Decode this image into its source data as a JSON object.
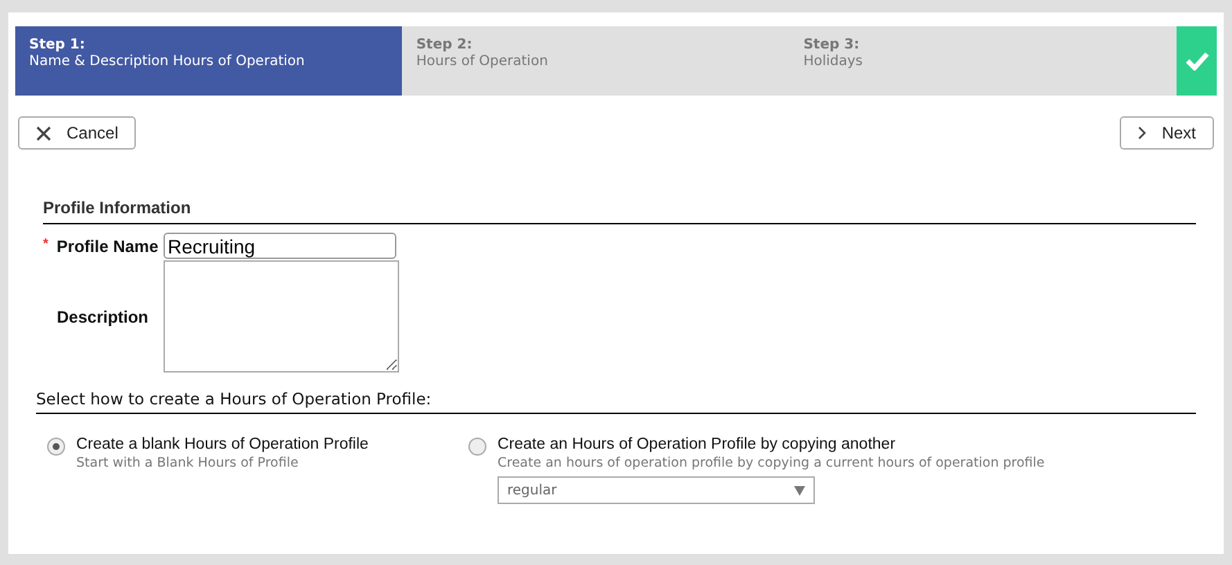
{
  "steps": [
    {
      "label": "Step 1:",
      "text": "Name & Description Hours of Operation",
      "selected": true
    },
    {
      "label": "Step 2:",
      "text": "Hours of Operation",
      "selected": false
    },
    {
      "label": "Step 3:",
      "text": "Holidays",
      "selected": false
    }
  ],
  "buttons": {
    "cancel": "Cancel",
    "next": "Next"
  },
  "profile_section": {
    "title": "Profile Information",
    "name_label": "Profile Name",
    "required_mark": "*",
    "name_value": "Recruiting",
    "description_label": "Description"
  },
  "create_section": {
    "title": "Select how to create a Hours of Operation Profile:",
    "options": [
      {
        "label": "Create a blank Hours of Operation Profile",
        "hint": "Start with a Blank Hours of Profile",
        "selected": true
      },
      {
        "label": "Create an Hours of Operation Profile by copying another",
        "hint": "Create an hours of operation profile by copying a current hours of operation profile",
        "selected": false,
        "dropdown": "regular"
      }
    ]
  }
}
